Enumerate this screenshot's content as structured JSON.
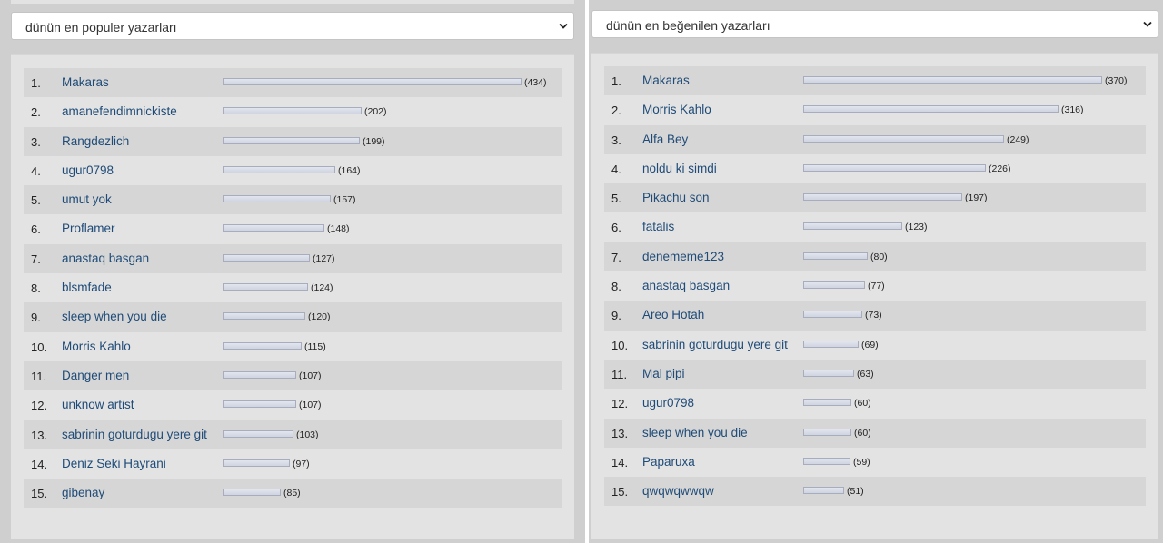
{
  "left": {
    "dropdown_label": "dünün en populer yazarları",
    "rows": [
      {
        "rank": "1.",
        "name": "Makaras",
        "value": 434
      },
      {
        "rank": "2.",
        "name": "amanefendimnickiste",
        "value": 202
      },
      {
        "rank": "3.",
        "name": "Rangdezlich",
        "value": 199
      },
      {
        "rank": "4.",
        "name": "ugur0798",
        "value": 164
      },
      {
        "rank": "5.",
        "name": "umut yok",
        "value": 157
      },
      {
        "rank": "6.",
        "name": "Proflamer",
        "value": 148
      },
      {
        "rank": "7.",
        "name": "anastaq basgan",
        "value": 127
      },
      {
        "rank": "8.",
        "name": "blsmfade",
        "value": 124
      },
      {
        "rank": "9.",
        "name": "sleep when you die",
        "value": 120
      },
      {
        "rank": "10.",
        "name": "Morris Kahlo",
        "value": 115
      },
      {
        "rank": "11.",
        "name": "Danger men",
        "value": 107
      },
      {
        "rank": "12.",
        "name": "unknow artist",
        "value": 107
      },
      {
        "rank": "13.",
        "name": "sabrinin goturdugu yere git",
        "value": 103
      },
      {
        "rank": "14.",
        "name": "Deniz Seki Hayrani",
        "value": 97
      },
      {
        "rank": "15.",
        "name": "gibenay",
        "value": 85
      }
    ]
  },
  "right": {
    "dropdown_label": "dünün en beğenilen yazarları",
    "rows": [
      {
        "rank": "1.",
        "name": "Makaras",
        "value": 370
      },
      {
        "rank": "2.",
        "name": "Morris Kahlo",
        "value": 316
      },
      {
        "rank": "3.",
        "name": "Alfa Bey",
        "value": 249
      },
      {
        "rank": "4.",
        "name": "noldu ki simdi",
        "value": 226
      },
      {
        "rank": "5.",
        "name": "Pikachu son",
        "value": 197
      },
      {
        "rank": "6.",
        "name": "fatalis",
        "value": 123
      },
      {
        "rank": "7.",
        "name": "denememe123",
        "value": 80
      },
      {
        "rank": "8.",
        "name": "anastaq basgan",
        "value": 77
      },
      {
        "rank": "9.",
        "name": "Areo Hotah",
        "value": 73
      },
      {
        "rank": "10.",
        "name": "sabrinin goturdugu yere git",
        "value": 69
      },
      {
        "rank": "11.",
        "name": "Mal pipi",
        "value": 63
      },
      {
        "rank": "12.",
        "name": "ugur0798",
        "value": 60
      },
      {
        "rank": "13.",
        "name": "sleep when you die",
        "value": 60
      },
      {
        "rank": "14.",
        "name": "Paparuxa",
        "value": 59
      },
      {
        "rank": "15.",
        "name": "qwqwqwwqw",
        "value": 51
      }
    ]
  },
  "colors": {
    "link": "#1f4b78",
    "bar_fill": "#d9dde8",
    "bar_border": "#a8adbd",
    "row_stripe": "#d6d6d6",
    "panel_bg": "#e3e3e3",
    "page_bg": "#cfcfcf"
  }
}
